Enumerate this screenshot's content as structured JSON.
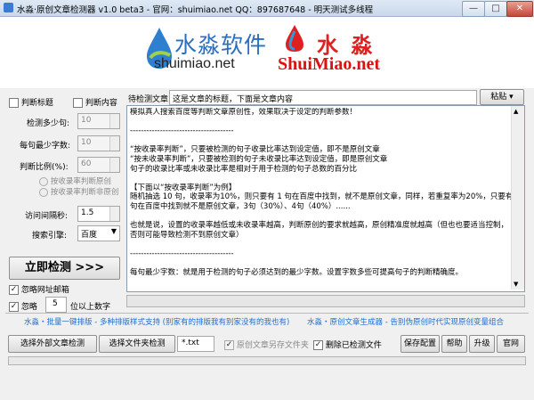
{
  "window": {
    "title": "水淼·原创文章检测器 v1.0 beta3 - 官网：shuimiao.net  QQ：897687648 - 明天测试多线程",
    "min": "—",
    "max": "□",
    "close": "✕"
  },
  "banner": {
    "logo1_cn": "水淼软件",
    "logo1_en": "shuimiao.net",
    "logo2_cn": "水 淼",
    "logo2_en": "ShuiMiao.net"
  },
  "left": {
    "check_title": "判断标题",
    "check_content": "判断内容",
    "min_sentences_label": "检测多少句:",
    "min_sentences_value": "10",
    "min_chars_label": "每句最少字数:",
    "min_chars_value": "10",
    "ratio_label": "判断比例(%):",
    "ratio_value": "60",
    "radio_a": "按收录率判断原创",
    "radio_b": "按收录率判断非原创",
    "interval_label": "访问间隔秒:",
    "interval_value": "1.5",
    "engine_label": "搜索引擎:",
    "engine_value": "百度",
    "detect_button": "立即检测 >>>",
    "ignore_url": "忽略网址邮箱",
    "ignore_digits_label": "忽略",
    "ignore_digits_value": "5",
    "ignore_digits_suffix": "位以上数字"
  },
  "main": {
    "article_label": "待检测文章:",
    "article_title_value": "这是文章的标题，下面是文章内容",
    "paste_button": "粘贴",
    "lines": [
      "模拟真人搜索百度等判断文章原创性，效果取决于设定的判断参数！",
      "",
      "--------------------------------------",
      "",
      "“按收录率判断”，只要被检测的句子收录比率达到设定值，即不是原创文章",
      "“按未收录率判断”，只要被检测的句子未收录比率达到设定值，即是原创文章",
      "句子的收录比率或未收录比率是相对于用于检测的句子总数的百分比",
      "",
      "【下面以“按收录率判断”为例】",
      "随机抽选 10 句，收录率为10%，则只要有 1 句在百度中找到，就不是原创文章，同样，若重复率为20%，只要有2",
      "句在百度中找到就不是原创文章，3句（30%）、4句（40%）......",
      "",
      "也就是说，设置的收录率越低或未收录率越高，判断原创的要求就越高，原创精准度就越高（但也也要适当控制，",
      "否则可能导致检测不到原创文章）",
      "",
      "--------------------------------------",
      "",
      "每句最少字数：就是用于检测的句子必须达到的最少字数。设置字数多些可提高句子的判断精确度。"
    ]
  },
  "ad": {
    "left": "水淼・批量一键排版 - 多种排版样式支持 (别家有的排版我有别家没有的我也有)",
    "right": "水淼・原创文章生成器 - 告别伪原创时代实现原创变量组合"
  },
  "bottom": {
    "select_external": "选择外部文章检测",
    "select_folder": "选择文件夹检测",
    "ext_value": "*.txt",
    "save_original": "原创文章另存文件夹",
    "delete_checked": "删除已检测文件",
    "save_config": "保存配置",
    "help": "帮助",
    "upgrade": "升级",
    "website": "官网"
  }
}
